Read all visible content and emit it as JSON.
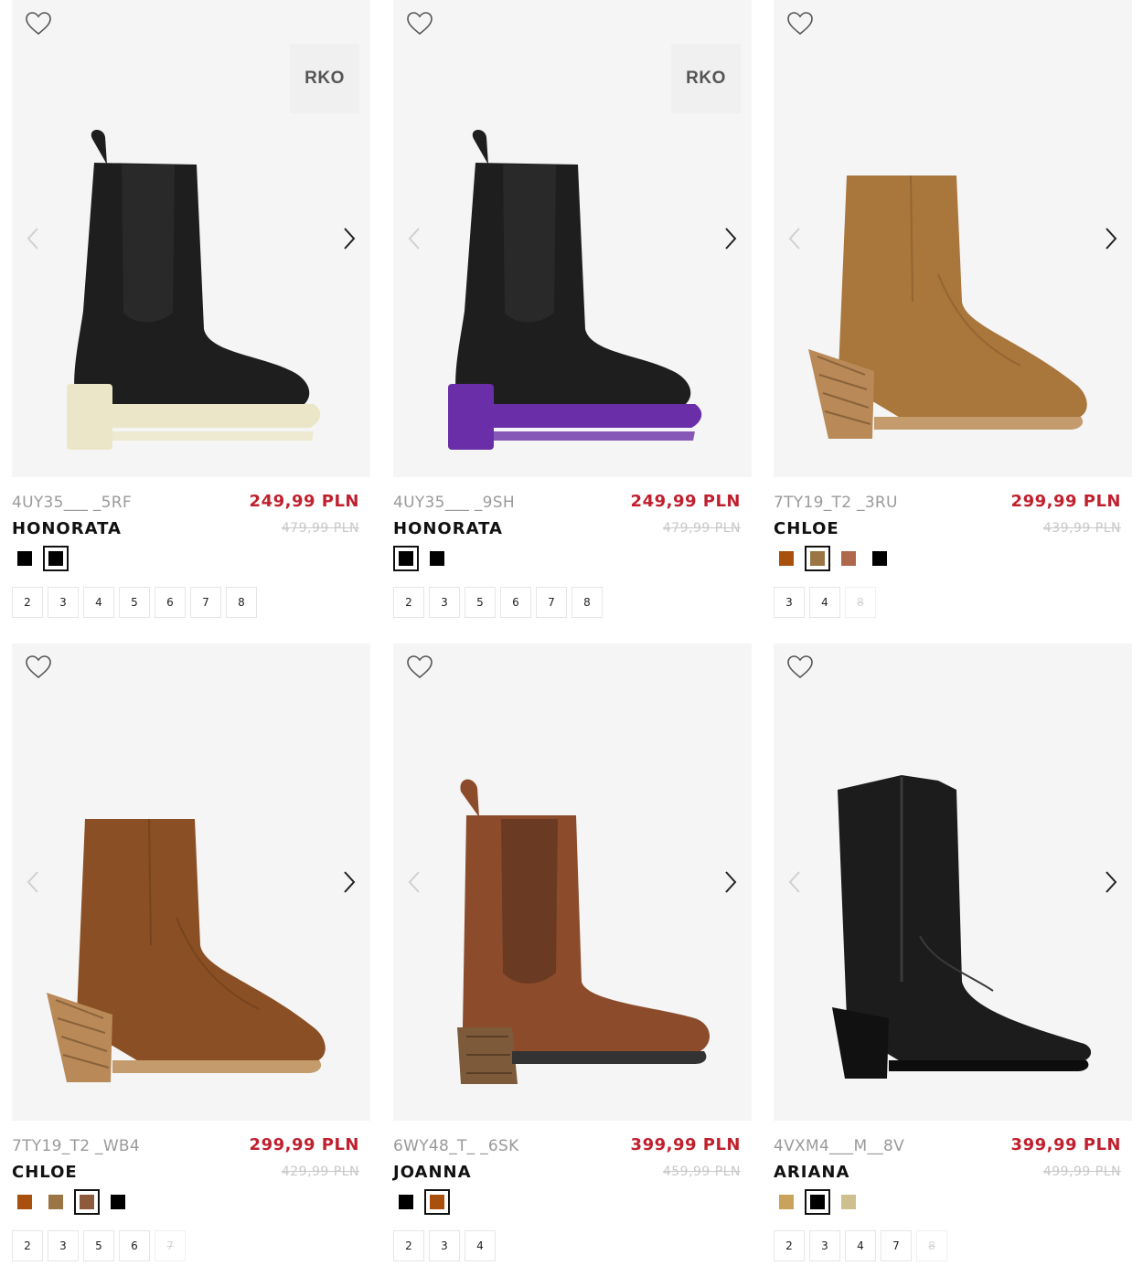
{
  "products": [
    {
      "code": "4UY35___ _5RF",
      "name": "HONORATA",
      "price": "249,99 PLN",
      "old_price": "479,99 PLN",
      "badge": "RKO",
      "boot_type": "chelsea-platform",
      "boot_color": "#1e1e1e",
      "sole_color": "#ece6c8",
      "swatches": [
        {
          "color": "#000000",
          "selected": false
        },
        {
          "color": "#000000",
          "selected": true
        }
      ],
      "sizes": [
        {
          "label": "2",
          "available": true
        },
        {
          "label": "3",
          "available": true
        },
        {
          "label": "4",
          "available": true
        },
        {
          "label": "5",
          "available": true
        },
        {
          "label": "6",
          "available": true
        },
        {
          "label": "7",
          "available": true
        },
        {
          "label": "8",
          "available": true
        }
      ]
    },
    {
      "code": "4UY35___ _9SH",
      "name": "HONORATA",
      "price": "249,99 PLN",
      "old_price": "479,99 PLN",
      "badge": "RKO",
      "boot_type": "chelsea-platform",
      "boot_color": "#1e1e1e",
      "sole_color": "#6a2fa8",
      "swatches": [
        {
          "color": "#000000",
          "selected": true
        },
        {
          "color": "#000000",
          "selected": false
        }
      ],
      "sizes": [
        {
          "label": "2",
          "available": true
        },
        {
          "label": "3",
          "available": true
        },
        {
          "label": "5",
          "available": true
        },
        {
          "label": "6",
          "available": true
        },
        {
          "label": "7",
          "available": true
        },
        {
          "label": "8",
          "available": true
        }
      ]
    },
    {
      "code": "7TY19_T2 _3RU",
      "name": "CHLOE",
      "price": "299,99 PLN",
      "old_price": "439,99 PLN",
      "badge": "",
      "boot_type": "western-ankle",
      "boot_color": "#a9763b",
      "sole_color": "#c49b6d",
      "swatches": [
        {
          "color": "#a9500f",
          "selected": false
        },
        {
          "color": "#9b7544",
          "selected": true
        },
        {
          "color": "#b0684a",
          "selected": false
        },
        {
          "color": "#000000",
          "selected": false
        }
      ],
      "sizes": [
        {
          "label": "3",
          "available": true
        },
        {
          "label": "4",
          "available": true
        },
        {
          "label": "8",
          "available": false
        }
      ]
    },
    {
      "code": "7TY19_T2 _WB4",
      "name": "CHLOE",
      "price": "299,99 PLN",
      "old_price": "429,99 PLN",
      "badge": "",
      "boot_type": "western-ankle",
      "boot_color": "#8a4f24",
      "sole_color": "#c49b6d",
      "swatches": [
        {
          "color": "#a9500f",
          "selected": false
        },
        {
          "color": "#9b7544",
          "selected": false
        },
        {
          "color": "#8d5a3b",
          "selected": true
        },
        {
          "color": "#000000",
          "selected": false
        }
      ],
      "sizes": [
        {
          "label": "2",
          "available": true
        },
        {
          "label": "3",
          "available": true
        },
        {
          "label": "5",
          "available": true
        },
        {
          "label": "6",
          "available": true
        },
        {
          "label": "7",
          "available": false
        }
      ]
    },
    {
      "code": "6WY48_T_ _6SK",
      "name": "JOANNA",
      "price": "399,99 PLN",
      "old_price": "459,99 PLN",
      "badge": "",
      "boot_type": "chelsea-heel",
      "boot_color": "#8c4c2c",
      "sole_color": "#7a5a3a",
      "swatches": [
        {
          "color": "#000000",
          "selected": false
        },
        {
          "color": "#a9500f",
          "selected": true
        }
      ],
      "sizes": [
        {
          "label": "2",
          "available": true
        },
        {
          "label": "3",
          "available": true
        },
        {
          "label": "4",
          "available": true
        }
      ]
    },
    {
      "code": "4VXM4___M__8V",
      "name": "ARIANA",
      "price": "399,99 PLN",
      "old_price": "499,99 PLN",
      "badge": "",
      "boot_type": "cowboy",
      "boot_color": "#1c1c1c",
      "sole_color": "#111111",
      "swatches": [
        {
          "color": "#c9a25c",
          "selected": false
        },
        {
          "color": "#000000",
          "selected": true
        },
        {
          "color": "#cdc08e",
          "selected": false
        }
      ],
      "sizes": [
        {
          "label": "2",
          "available": true
        },
        {
          "label": "3",
          "available": true
        },
        {
          "label": "4",
          "available": true
        },
        {
          "label": "7",
          "available": true
        },
        {
          "label": "8",
          "available": false
        }
      ]
    }
  ]
}
